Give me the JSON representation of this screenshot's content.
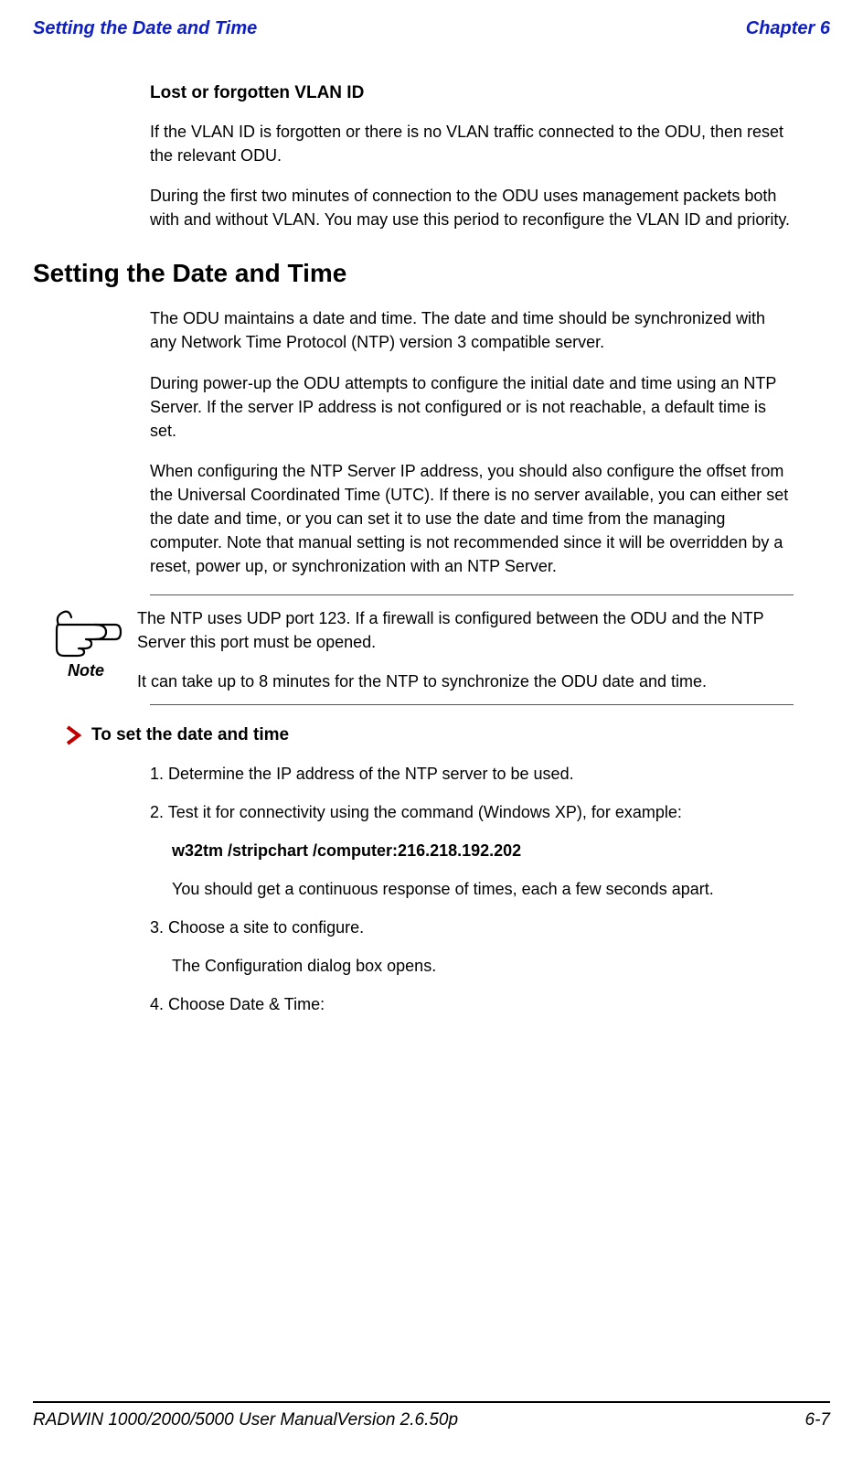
{
  "header": {
    "left": "Setting the Date and Time",
    "right": "Chapter 6"
  },
  "section1": {
    "title": "Lost or forgotten VLAN ID",
    "p1": "If the VLAN ID is forgotten or there is no VLAN traffic connected to the ODU, then reset the relevant ODU.",
    "p2": "During the first two minutes of connection to the ODU uses management packets both with and without VLAN. You may use this period to reconfigure the VLAN ID and priority."
  },
  "h1": "Setting the Date and Time",
  "section2": {
    "p1": "The ODU maintains a date and time. The date and time should be synchronized with any Network Time Protocol (NTP) version 3 compatible server.",
    "p2": "During power-up the ODU attempts to configure the initial date and time using an NTP Server. If the server IP address is not configured or is not reachable, a default time is set.",
    "p3": "When configuring the NTP Server IP address, you should also configure the offset from the Universal Coordinated Time (UTC). If there is no server available, you can either set the date and time, or you can set it to use the date and time from the managing computer. Note that manual setting is not recommended since it will be overridden by a reset, power up, or synchronization with an NTP Server."
  },
  "note": {
    "label": "Note",
    "p1": "The NTP uses UDP port 123. If a firewall is configured between the ODU and the NTP Server this port must be opened.",
    "p2": "It can take up to 8 minutes for the NTP to synchronize the ODU date and time."
  },
  "procedure": {
    "title": "To set the date and time",
    "step1": "1. Determine the IP address of the NTP server to be used.",
    "step2": "2.  Test it for connectivity using the command (Windows XP), for example:",
    "step2cmd": "w32tm /stripchart /computer:216.218.192.202",
    "step2res": "You should get a continuous response of times, each a few seconds apart.",
    "step3": "3. Choose a site to configure.",
    "step3res": "The Configuration dialog box opens.",
    "step4": "4. Choose Date & Time:"
  },
  "footer": {
    "left": "RADWIN 1000/2000/5000 User ManualVersion  2.6.50p",
    "right": "6-7"
  }
}
